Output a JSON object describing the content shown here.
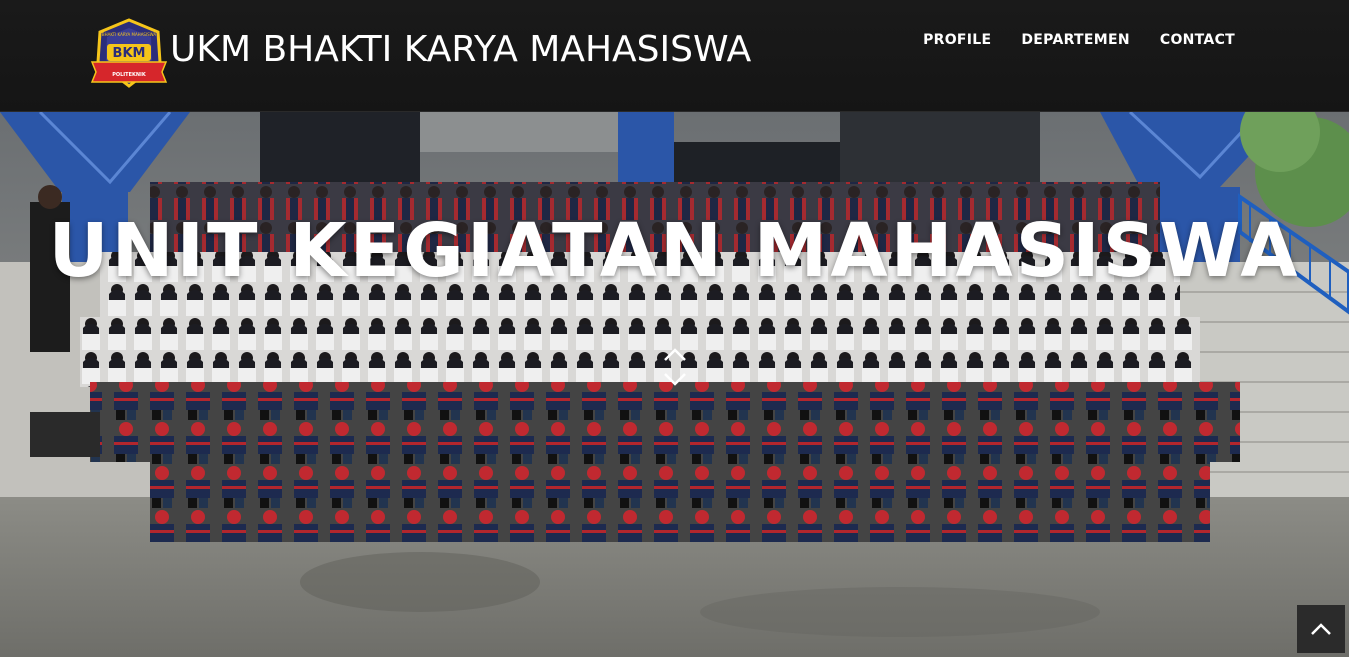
{
  "brand": {
    "title": "UKM BHAKTI KARYA MAHASISWA",
    "logo_text": "BKM",
    "logo_arc_text": "BHAKTI KARYA MAHASISWA",
    "logo_sub_text": "POLITEKNIK"
  },
  "nav": {
    "items": [
      {
        "label": "PROFILE"
      },
      {
        "label": "DEPARTEMEN"
      },
      {
        "label": "CONTACT"
      }
    ]
  },
  "hero": {
    "title": "UNIT KEGIATAN MAHASISWA"
  },
  "icons": {
    "scroll_down": "chevron-up-down-icon",
    "back_to_top": "chevron-up-icon"
  },
  "colors": {
    "navbar": "#151515",
    "logo_blue": "#2b2d7a",
    "logo_red": "#d6262b",
    "logo_gold": "#f5c51a",
    "uniform_red": "#b3262d",
    "uniform_navy": "#1d2a4f"
  }
}
